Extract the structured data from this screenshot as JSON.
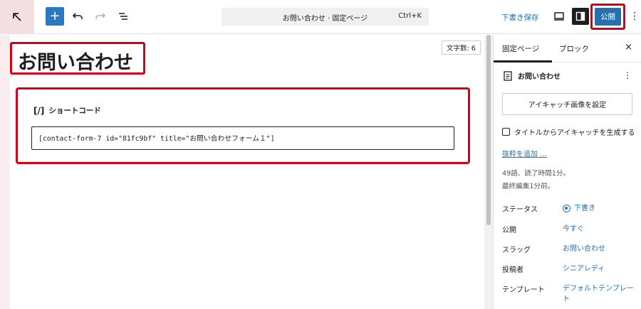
{
  "toolbar": {
    "add_symbol": "+",
    "command_title": "お問い合わせ · 固定ページ",
    "command_shortcut": "Ctrl+K",
    "save_draft": "下書き保存",
    "publish": "公開",
    "more": "⋮"
  },
  "editor": {
    "word_count": "文字数: 6",
    "title": "お問い合わせ",
    "block_icon": "[/]",
    "block_label": "ショートコード",
    "shortcode_value": "[contact-form-7 id=\"81fc9bf\" title=\"お問い合わせフォーム１\"]"
  },
  "sidebar": {
    "tab_page": "固定ページ",
    "tab_block": "ブロック",
    "close": "×",
    "doc_title": "お問い合わせ",
    "doc_more": "⋮",
    "featured_image_button": "アイキャッチ画像を設定",
    "generate_featured_label": "タイトルからアイキャッチを生成する",
    "excerpt_link": "抜粋を追加 ...",
    "stats_words": "49語、読了時間1分。",
    "stats_edited": "最終編集1分前。",
    "meta": [
      {
        "key": "ステータス",
        "value": "下書き"
      },
      {
        "key": "公開",
        "value": "今すぐ"
      },
      {
        "key": "スラッグ",
        "value": "お問い合わせ"
      },
      {
        "key": "投稿者",
        "value": "シニアレディ"
      },
      {
        "key": "テンプレート",
        "value": "デフォルトテンプレート"
      }
    ]
  },
  "colors": {
    "accent": "#2271b1",
    "highlight_border": "#d0021b"
  }
}
